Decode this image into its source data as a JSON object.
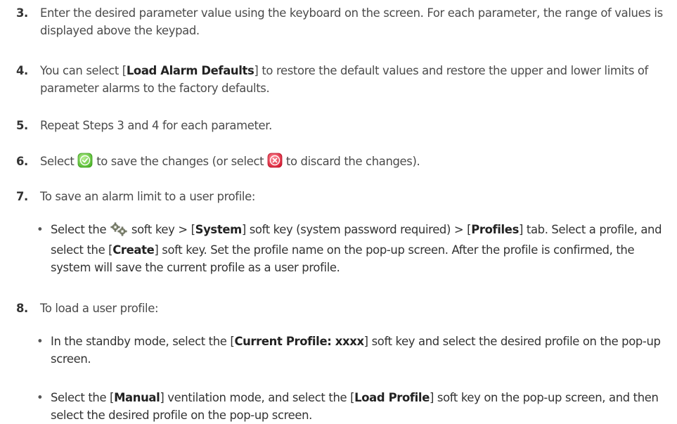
{
  "steps": [
    {
      "num": "3.",
      "text": "Enter the desired parameter value using the keyboard on the screen. For each parameter, the range of values is displayed above the keypad."
    },
    {
      "num": "4.",
      "pre": "You can select [",
      "bold": "Load Alarm Defaults",
      "post": "] to restore the default values and restore the upper and lower limits of parameter alarms to the factory defaults."
    },
    {
      "num": "5.",
      "text": "Repeat Steps 3 and 4 for each parameter."
    },
    {
      "num": "6.",
      "a": "Select ",
      "b": " to save the changes (or select ",
      "c": " to discard the changes)."
    },
    {
      "num": "7.",
      "text": "To save an alarm limit to a user profile:"
    },
    {
      "num": "8.",
      "text": "To load a user profile:"
    }
  ],
  "sub7": {
    "bullet": "•",
    "t1": "Select the ",
    "t2": " soft key > [",
    "b1": "System",
    "t3": "] soft key (system password required) > [",
    "b2": "Profiles",
    "t4": "] tab. Select a profile, and select the [",
    "b3": "Create",
    "t5": "] soft key. Set the profile name on the pop-up screen. After the profile is confirmed, the system will save the current profile as a user profile."
  },
  "sub8a": {
    "bullet": "•",
    "t1": "In the standby mode, select the [",
    "b1": "Current Profile: xxxx",
    "t2": "] soft key and select the desired profile on the pop-up screen."
  },
  "sub8b": {
    "bullet": "•",
    "t1": "Select the [",
    "b1": "Manual",
    "t2": "] ventilation mode, and select the [",
    "b2": "Load Profile",
    "t3": "] soft key on the pop-up screen, and then select the desired profile on the pop-up screen."
  },
  "icons": {
    "confirm": "check-icon",
    "cancel": "close-icon",
    "setup": "gears-icon",
    "confirm_color": "#7bd64a",
    "cancel_color": "#e8364a"
  }
}
